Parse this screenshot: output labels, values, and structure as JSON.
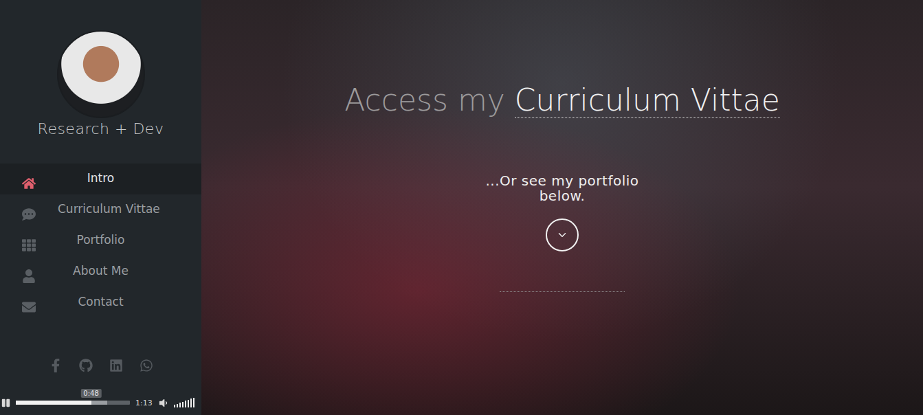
{
  "sidebar": {
    "tagline": "Research + Dev",
    "nav": [
      {
        "label": "Intro",
        "selected": true
      },
      {
        "label": "Curriculum Vittae",
        "selected": false
      },
      {
        "label": "Portfolio",
        "selected": false
      },
      {
        "label": "About Me",
        "selected": false
      },
      {
        "label": "Contact",
        "selected": false
      }
    ]
  },
  "player": {
    "playing": true,
    "level": 0.66,
    "buffered": 0.8,
    "tooltip": "0:48",
    "duration": "1:13",
    "volume_level": 1
  },
  "hero": {
    "title_prefix": "Access my",
    "title_link": "Curriculum Vittae",
    "subtitle": "...Or see my portfolio below."
  }
}
